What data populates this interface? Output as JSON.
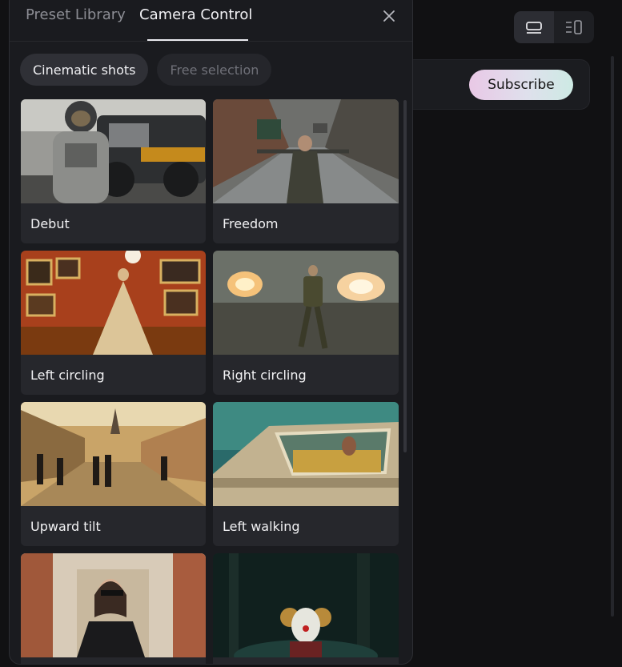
{
  "panel": {
    "tabs": [
      {
        "label": "Preset Library",
        "active": false
      },
      {
        "label": "Camera Control",
        "active": true
      }
    ],
    "chips": [
      {
        "label": "Cinematic shots",
        "active": true
      },
      {
        "label": "Free selection",
        "active": false
      }
    ],
    "presets": [
      {
        "label": "Debut",
        "thumb": "astronaut-rover"
      },
      {
        "label": "Freedom",
        "thumb": "man-rain-street"
      },
      {
        "label": "Left circling",
        "thumb": "gallery-gown"
      },
      {
        "label": "Right circling",
        "thumb": "soldier-explosions"
      },
      {
        "label": "Upward tilt",
        "thumb": "old-town-street"
      },
      {
        "label": "Left walking",
        "thumb": "man-in-car"
      },
      {
        "label": "",
        "thumb": "woman-sunglasses"
      },
      {
        "label": "",
        "thumb": "clown-dark-forest"
      }
    ]
  },
  "background": {
    "subscribe_label": "Subscribe",
    "view_toggle_icons": [
      "card-view-icon",
      "list-view-icon"
    ]
  },
  "colors": {
    "panel_bg": "#1a1b1f",
    "card_bg": "#26272c",
    "accent_gradient": [
      "#e9c8e6",
      "#cdeae4"
    ]
  }
}
